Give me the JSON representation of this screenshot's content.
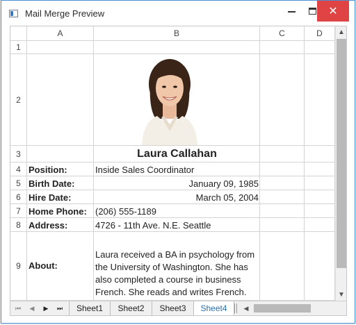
{
  "window": {
    "title": "Mail Merge Preview",
    "close_glyph": "✕"
  },
  "columns": [
    "A",
    "B",
    "C",
    "D"
  ],
  "rows": [
    "1",
    "2",
    "3",
    "4",
    "5",
    "6",
    "7",
    "8",
    "9"
  ],
  "record": {
    "name": "Laura Callahan",
    "fields": [
      {
        "label": "Position:",
        "value": "Inside Sales Coordinator"
      },
      {
        "label": "Birth Date:",
        "value": "January 09, 1985"
      },
      {
        "label": "Hire Date:",
        "value": "March 05, 2004"
      },
      {
        "label": "Home Phone:",
        "value": "(206) 555-1189"
      },
      {
        "label": "Address:",
        "value": "4726 - 11th Ave. N.E. Seattle"
      }
    ],
    "about_label": "About:",
    "about_text": "Laura received a BA in psychology from the University of Washington.  She has also completed a course in business French.  She reads and writes French."
  },
  "sheets": {
    "tabs": [
      "Sheet1",
      "Sheet2",
      "Sheet3",
      "Sheet4"
    ],
    "selected": "Sheet4",
    "nav": {
      "first": "⏮",
      "prev": "◀",
      "next": "▶",
      "last": "⏭"
    }
  },
  "scroll": {
    "up": "▲",
    "down": "▼",
    "left": "◀"
  },
  "icons": {
    "app": "spreadsheet-icon",
    "photo": "person-photo"
  },
  "colors": {
    "accent": "#2a6fb0",
    "close": "#e04343",
    "border": "#4a90d9"
  }
}
